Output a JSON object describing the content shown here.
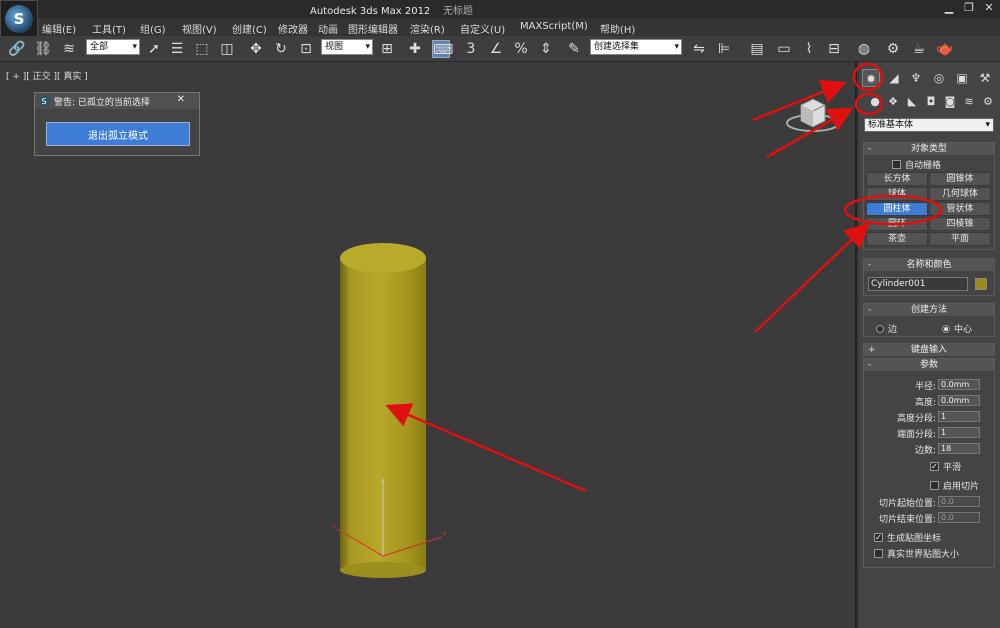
{
  "window": {
    "title": "Autodesk 3ds Max  2012",
    "title_file": "无标题"
  },
  "menu": [
    "编辑(E)",
    "工具(T)",
    "组(G)",
    "视图(V)",
    "创建(C)",
    "修改器",
    "动画",
    "图形编辑器",
    "渲染(R)",
    "自定义(U)",
    "MAXScript(M)",
    "帮助(H)"
  ],
  "toolbar": {
    "selection_filter": "全部",
    "coord_system": "视图",
    "named_selection": "创建选择集"
  },
  "viewport": {
    "label": "[ + ][ 正交 ][ 真实 ]"
  },
  "dialog": {
    "title": "警告: 已孤立的当前选择",
    "close": "✕",
    "button": "退出孤立模式"
  },
  "panel": {
    "category": "标准基本体",
    "object_type": {
      "header": "对象类型",
      "autogrid": "自动栅格",
      "buttons": [
        "长方体",
        "圆锥体",
        "球体",
        "几何球体",
        "圆柱体",
        "管状体",
        "圆环",
        "四棱锥",
        "茶壶",
        "平面"
      ],
      "selected": "圆柱体"
    },
    "name_color": {
      "header": "名称和颜色",
      "name": "Cylinder001",
      "color": "#9a8a16"
    },
    "creation_method": {
      "header": "创建方法",
      "edge": "边",
      "center": "中心"
    },
    "keyboard_entry": {
      "header": "键盘输入"
    },
    "parameters": {
      "header": "参数",
      "radius_label": "半径:",
      "radius": "0.0mm",
      "height_label": "高度:",
      "height": "0.0mm",
      "height_segs_label": "高度分段:",
      "height_segs": "1",
      "cap_segs_label": "端面分段:",
      "cap_segs": "1",
      "sides_label": "边数:",
      "sides": "18",
      "smooth": "平滑",
      "slice_on": "启用切片",
      "slice_from_label": "切片起始位置:",
      "slice_from": "0.0",
      "slice_to_label": "切片结束位置:",
      "slice_to": "0.0",
      "gen_map": "生成贴图坐标",
      "real_world": "真实世界贴图大小"
    }
  },
  "colors": {
    "accent": "#3d7dd6",
    "annotation": "#e01010",
    "cylinder": "#b4a41e"
  }
}
